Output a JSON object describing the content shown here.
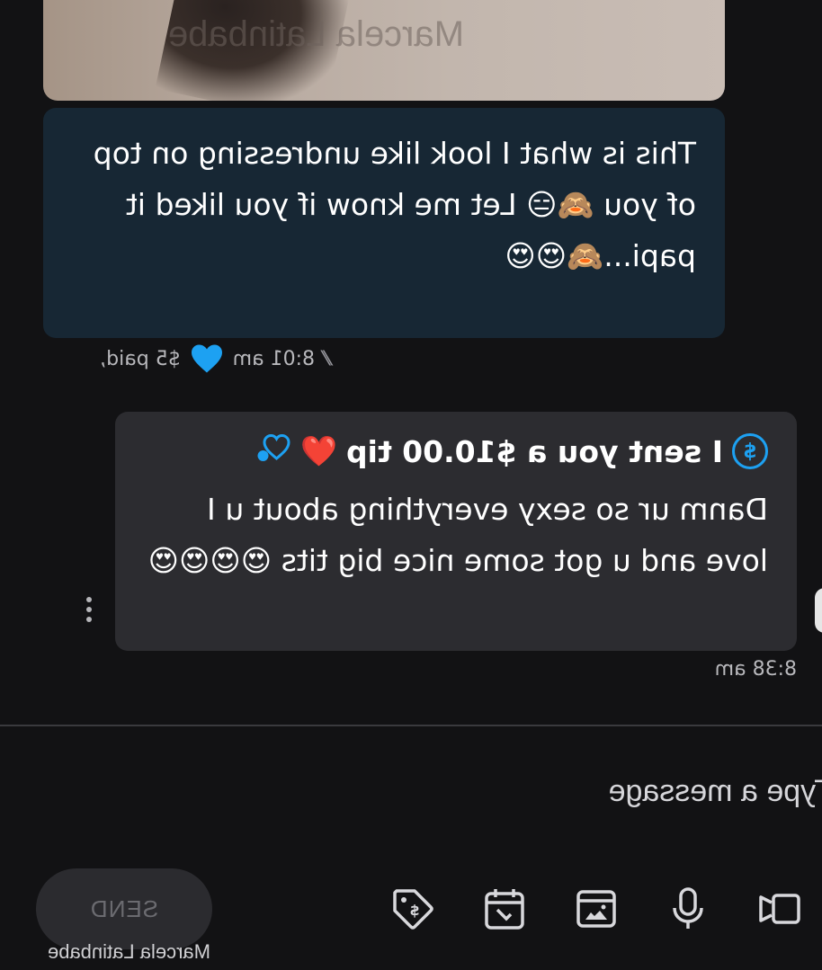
{
  "media": {
    "watermark": "Marcela Latinbabe"
  },
  "incoming": {
    "text": "This is what I look like undressing on top of you 🙈😑 Let me know if you liked it papi...🙈😍😍",
    "price": "$5 paid,",
    "time": "8:01 am",
    "heart_icon": "heart-icon",
    "status_icon": "double-check-icon",
    "colors": {
      "bubble": "#172734",
      "heart": "#1da1f2"
    }
  },
  "outgoing": {
    "tip_text": "I sent you a $10.00 tip",
    "tip_emoji": "❤️",
    "message": "Danm ur so sexy everything about u I love and u got some nice big tits 😍😍😍😍",
    "time": "8:38 am",
    "colors": {
      "bubble": "#2c2c30",
      "accent": "#1da1f2"
    }
  },
  "composer": {
    "placeholder": "Type a message",
    "send_label": "SEND",
    "watermark": "Marcela Latinbabe",
    "tools": [
      "media-icon",
      "mic-icon",
      "vault-image-icon",
      "schedule-icon",
      "price-tag-icon"
    ]
  }
}
